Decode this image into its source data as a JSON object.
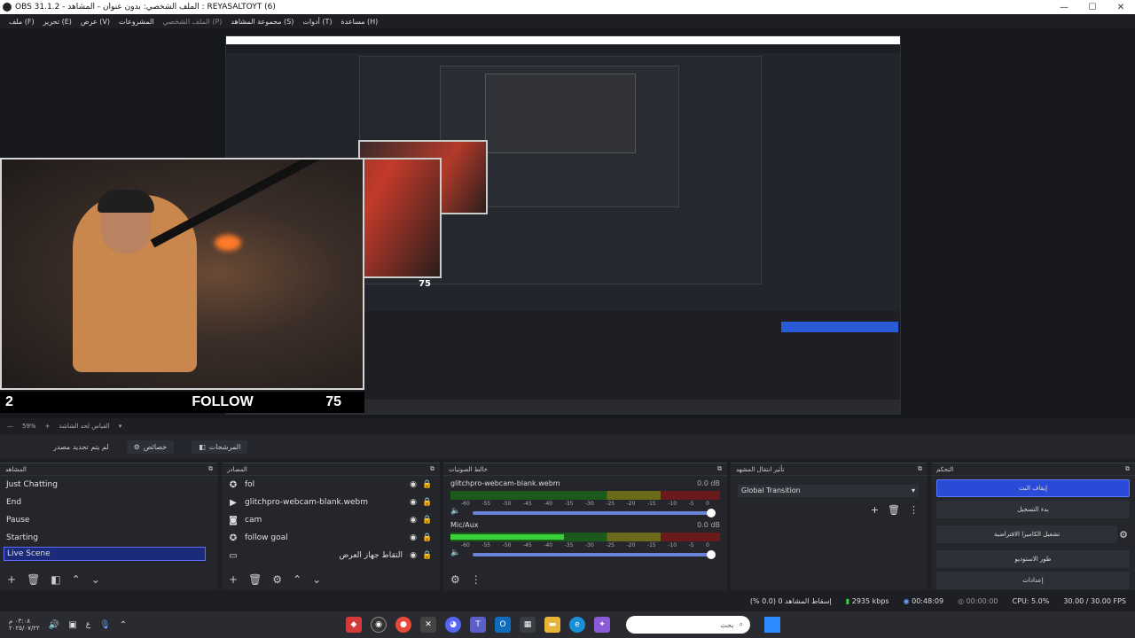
{
  "window": {
    "title": "OBS 31.1.2 - الملف الشخصي: بدون عنوان - المشاهد : REYASALTOYT (6)"
  },
  "menu": [
    "ملف (F)",
    "تحرير (E)",
    "عرض (V)",
    "المشروعات",
    "الملف الشخصي (P)",
    "مجموعة المشاهد (S)",
    "أدوات (T)",
    "مساعدة (H)"
  ],
  "overlay": {
    "count_left": "2",
    "follow_label": "FOLLOW",
    "count_right": "75",
    "inner_count": "75"
  },
  "zoom": {
    "percent": "59%",
    "label": "القياس لحد الشاشة"
  },
  "tabs": {
    "studio_mode": "لم يتم تحديد مصدر",
    "properties": "خصائص",
    "filters": "المرشحات"
  },
  "scenes": {
    "title": "المشاهد",
    "items": [
      "Just Chatting",
      "End",
      "Pause",
      "Starting",
      "Live Scene"
    ],
    "active": "Live Scene"
  },
  "sources": {
    "title": "المصادر",
    "items": [
      {
        "name": "fol",
        "icon": "✪"
      },
      {
        "name": "glitchpro-webcam-blank.webm",
        "icon": "▶"
      },
      {
        "name": "cam",
        "icon": "◙"
      },
      {
        "name": "follow goal",
        "icon": "✪"
      },
      {
        "name": "التقاط جهاز العرض",
        "icon": "▭"
      }
    ]
  },
  "mixer": {
    "title": "خالط الصوتيات",
    "tracks": [
      {
        "name": "glitchpro-webcam-blank.webm",
        "db": "0.0 dB",
        "level": 0
      },
      {
        "name": "Mic/Aux",
        "db": "0.0 dB",
        "level": 0.42
      }
    ],
    "ticks": [
      "-60",
      "-55",
      "-50",
      "-45",
      "-40",
      "-35",
      "-30",
      "-25",
      "-20",
      "-15",
      "-10",
      "-5",
      "0"
    ]
  },
  "transitions": {
    "title": "تأثير انتقال المشهد",
    "selected": "Global Transition"
  },
  "controls": {
    "title": "التحكم",
    "buttons": [
      "إيقاف البث",
      "بدء التسجيل",
      "تشغيل الكاميرا الافتراضية",
      "طور الاستوديو",
      "إعدادات"
    ]
  },
  "status": {
    "dropped": "إسقاط المشاهد 0 (0.0 %)",
    "bitrate": "2935 kbps",
    "live_time": "00:48:09",
    "rec_time": "00:00:00",
    "cpu": "CPU: 5.0%",
    "fps": "30.00 / 30.00 FPS"
  },
  "taskbar": {
    "time": "٠٣:٠٨ م",
    "date": "٢٠٢٥/٠٧/٢٢",
    "lang": "ع",
    "search_placeholder": "بحث"
  }
}
